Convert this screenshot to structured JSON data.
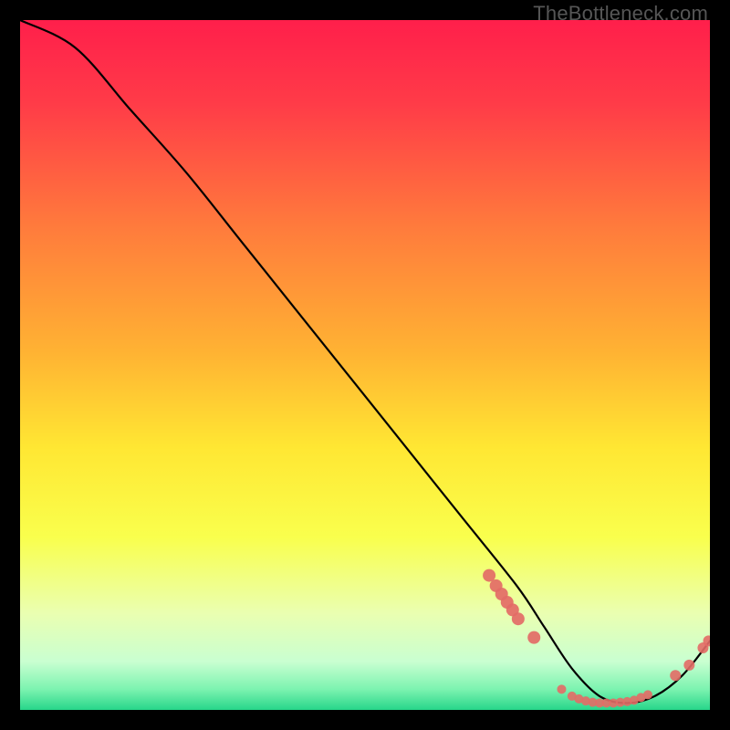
{
  "watermark": "TheBottleneck.com",
  "chart_data": {
    "type": "line",
    "title": "",
    "xlabel": "",
    "ylabel": "",
    "xlim": [
      0,
      100
    ],
    "ylim": [
      0,
      100
    ],
    "curve": {
      "name": "bottleneck-curve",
      "x": [
        0,
        8,
        16,
        24,
        32,
        40,
        48,
        56,
        64,
        72,
        76,
        80,
        84,
        88,
        92,
        96,
        100
      ],
      "y": [
        100,
        96,
        87,
        78,
        68,
        58,
        48,
        38,
        28,
        18,
        12,
        6,
        2,
        1,
        2,
        5,
        10
      ]
    },
    "markers_left_slope": {
      "name": "markers-descent",
      "color": "#e36b66",
      "points": [
        {
          "x": 68.0,
          "y": 19.5
        },
        {
          "x": 69.0,
          "y": 18.0
        },
        {
          "x": 69.8,
          "y": 16.8
        },
        {
          "x": 70.6,
          "y": 15.6
        },
        {
          "x": 71.4,
          "y": 14.5
        },
        {
          "x": 72.2,
          "y": 13.2
        },
        {
          "x": 74.5,
          "y": 10.5
        }
      ]
    },
    "markers_valley": {
      "name": "markers-valley",
      "color": "#e36b66",
      "points": [
        {
          "x": 78.5,
          "y": 3.0
        },
        {
          "x": 80.0,
          "y": 2.0
        },
        {
          "x": 81.0,
          "y": 1.6
        },
        {
          "x": 82.0,
          "y": 1.3
        },
        {
          "x": 83.0,
          "y": 1.1
        },
        {
          "x": 84.0,
          "y": 1.0
        },
        {
          "x": 85.0,
          "y": 1.0
        },
        {
          "x": 86.0,
          "y": 1.0
        },
        {
          "x": 87.0,
          "y": 1.1
        },
        {
          "x": 88.0,
          "y": 1.2
        },
        {
          "x": 89.0,
          "y": 1.4
        },
        {
          "x": 90.0,
          "y": 1.8
        },
        {
          "x": 91.0,
          "y": 2.2
        }
      ]
    },
    "markers_right_slope": {
      "name": "markers-ascent",
      "color": "#e36b66",
      "points": [
        {
          "x": 95.0,
          "y": 5.0
        },
        {
          "x": 97.0,
          "y": 6.5
        },
        {
          "x": 99.0,
          "y": 9.0
        },
        {
          "x": 99.8,
          "y": 10.0
        }
      ]
    },
    "gradient_stops": [
      {
        "offset": 0.0,
        "color": "#ff1f4b"
      },
      {
        "offset": 0.12,
        "color": "#ff3b48"
      },
      {
        "offset": 0.3,
        "color": "#ff7b3c"
      },
      {
        "offset": 0.48,
        "color": "#ffb233"
      },
      {
        "offset": 0.62,
        "color": "#ffe733"
      },
      {
        "offset": 0.75,
        "color": "#f9ff4d"
      },
      {
        "offset": 0.86,
        "color": "#eaffb1"
      },
      {
        "offset": 0.93,
        "color": "#c9ffd1"
      },
      {
        "offset": 0.97,
        "color": "#7cf3b0"
      },
      {
        "offset": 1.0,
        "color": "#27d68a"
      }
    ]
  }
}
